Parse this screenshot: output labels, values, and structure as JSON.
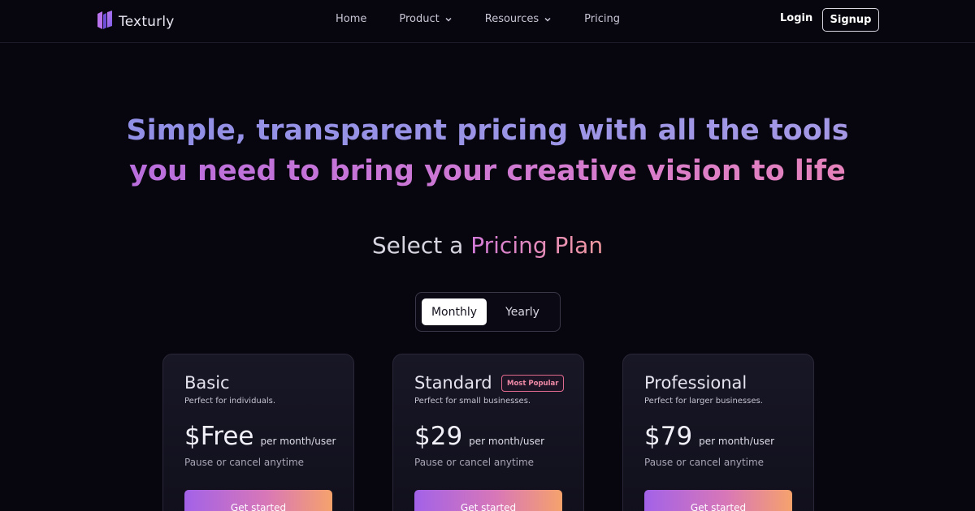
{
  "nav": {
    "brand": "Texturly",
    "links": [
      {
        "label": "Home",
        "has_dropdown": false
      },
      {
        "label": "Product",
        "has_dropdown": true
      },
      {
        "label": "Resources",
        "has_dropdown": true
      },
      {
        "label": "Pricing",
        "has_dropdown": false
      }
    ],
    "login_label": "Login",
    "signup_label": "Signup"
  },
  "hero": {
    "line1": "Simple, transparent pricing with all the tools",
    "line2": "you need to bring your creative vision to life"
  },
  "plans_heading": {
    "prefix": "Select a",
    "highlight": "Pricing Plan"
  },
  "billing_toggle": {
    "options": [
      "Monthly",
      "Yearly"
    ],
    "selected": "Monthly"
  },
  "plans": [
    {
      "name": "Basic",
      "description": "Perfect for individuals.",
      "price": "$Free",
      "unit": "per month/user",
      "note": "Pause or cancel anytime",
      "cta": "Get started",
      "badge": ""
    },
    {
      "name": "Standard",
      "description": "Perfect for small businesses.",
      "price": "$29",
      "unit": "per month/user",
      "note": "Pause or cancel anytime",
      "cta": "Get started",
      "badge": "Most Popular"
    },
    {
      "name": "Professional",
      "description": "Perfect for larger businesses.",
      "price": "$79",
      "unit": "per month/user",
      "note": "Pause or cancel anytime",
      "cta": "Get started",
      "badge": ""
    }
  ],
  "colors": {
    "background": "#07060e",
    "accent_purple": "#a262e8",
    "accent_pink": "#d877b8",
    "accent_orange": "#f6a26c",
    "badge": "#e06a8e"
  },
  "icons": {
    "brand": "texturly-logo-icon",
    "dropdown": "chevron-down-icon"
  }
}
